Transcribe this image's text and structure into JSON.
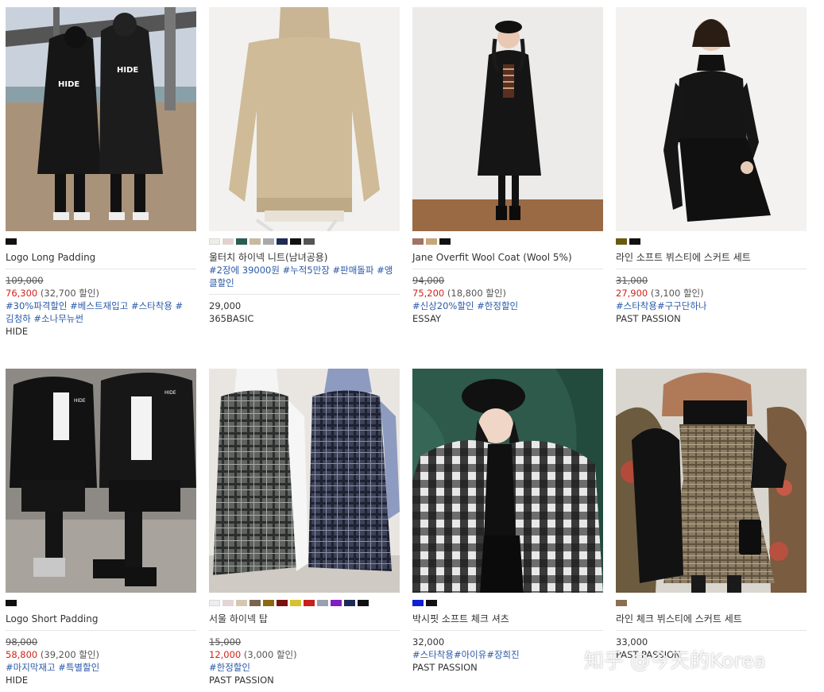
{
  "products": [
    {
      "image_alt": "two people in black long padded coats by a river",
      "swatches": [
        "#111111"
      ],
      "name": "Logo Long Padding",
      "orig_price": "109,000",
      "sale_price": "76,300",
      "discount": "(32,700 할인)",
      "tags": [
        "#30%파격할인 #베스트재입고 #스타착용 #",
        "김청하 #소나무뉴썬"
      ],
      "brand": "HIDE"
    },
    {
      "image_alt": "beige oversized turtleneck knit",
      "swatches": [
        "#efeee6",
        "#e6cfcf",
        "#2a5e4e",
        "#c9b9a0",
        "#a9a9a9",
        "#1f2a55",
        "#111111",
        "#555555"
      ],
      "name": "울터치 하이넥 니트(남녀공용)",
      "name_tags": [
        "#2장에 39000원 #누적5만장 #판매돌파 #앵",
        "클할인"
      ],
      "price": "29,000",
      "brand": "365BASIC"
    },
    {
      "image_alt": "woman in long black wool coat and beret",
      "swatches": [
        "#a07362",
        "#c7a679",
        "#111111"
      ],
      "name": "Jane Overfit Wool Coat (Wool 5%)",
      "orig_price": "94,000",
      "sale_price": "75,200",
      "discount": "(18,800 할인)",
      "tags": [
        "#신상20%할인 #한정할인"
      ],
      "brand": "ESSAY"
    },
    {
      "image_alt": "woman in black turtleneck and black bustier skirt set",
      "swatches": [
        "#6a5a10",
        "#111111"
      ],
      "name": "라인 소프트 뷔스티에 스커트 세트",
      "orig_price": "31,000",
      "sale_price": "27,900",
      "discount": "(3,100 할인)",
      "tags": [
        "#스타착용#구구단하나"
      ],
      "brand": "PAST PASSION"
    },
    {
      "image_alt": "two people in black short padded jackets sitting",
      "swatches": [
        "#111111"
      ],
      "name": "Logo Short Padding",
      "orig_price": "98,000",
      "sale_price": "58,800",
      "discount": "(39,200 할인)",
      "tags": [
        "#마지막재고 #특별할인"
      ],
      "brand": "HIDE"
    },
    {
      "image_alt": "two women in turtlenecks and plaid pinafore dresses",
      "swatches": [
        "#eeeeee",
        "#e8d3d3",
        "#d6c7b0",
        "#7a6450",
        "#8a6a10",
        "#7a1010",
        "#d8c030",
        "#c8201d",
        "#9aa0b0",
        "#8020c0",
        "#1f2a55",
        "#111111"
      ],
      "name": "서울 하이넥 탑",
      "orig_price": "15,000",
      "sale_price": "12,000",
      "discount": "(3,000 할인)",
      "tags": [
        "#한정할인"
      ],
      "brand": "PAST PASSION"
    },
    {
      "image_alt": "woman with beret in black and white check shirt on green velvet",
      "swatches": [
        "#1020d0",
        "#111111"
      ],
      "name": "박시핏 소프트 체크 셔츠",
      "price": "32,000",
      "tags": [
        "#스타착용#아이유#장희진"
      ],
      "brand": "PAST PASSION"
    },
    {
      "image_alt": "woman in plaid bustier skirt set outdoors",
      "swatches": [
        "#8a7050"
      ],
      "name": "라인 체크 뷔스티에 스커트 세트",
      "price": "33,000",
      "brand": "PAST PASSION"
    }
  ],
  "watermark": "知乎 @今天的Korea"
}
